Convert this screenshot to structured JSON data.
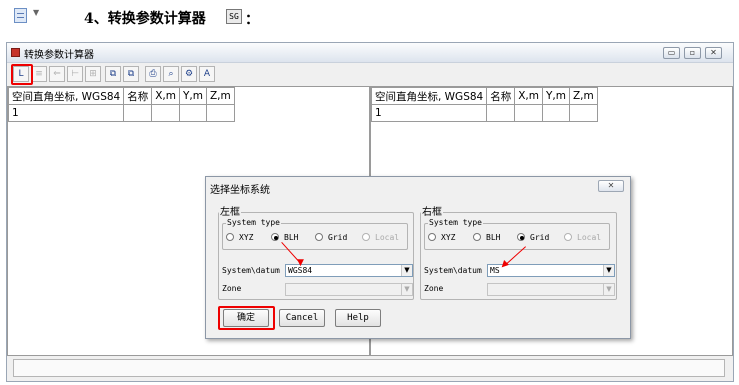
{
  "doc": {
    "heading": "4、转换参数计算器",
    "heading_icon_text": "SG",
    "heading_colon": "："
  },
  "window": {
    "title": "转换参数计算器",
    "controls": [
      "▭",
      "▫",
      "✕"
    ],
    "toolbar": [
      {
        "icon": "new-table-icon",
        "glyph": "L",
        "enabled": true,
        "highlighted": true
      },
      {
        "icon": "open-icon",
        "glyph": "≡",
        "enabled": false
      },
      {
        "icon": "import-icon",
        "glyph": "⇐",
        "enabled": false
      },
      {
        "icon": "export-icon",
        "glyph": "⊢",
        "enabled": false
      },
      {
        "icon": "calculate-icon",
        "glyph": "⊞",
        "enabled": false
      },
      {
        "icon": "copy-left-icon",
        "glyph": "⧉",
        "enabled": true
      },
      {
        "icon": "copy-right-icon",
        "glyph": "⧉",
        "enabled": true
      },
      {
        "icon": "print-icon",
        "glyph": "⎙",
        "enabled": true
      },
      {
        "icon": "preview-icon",
        "glyph": "⌕",
        "enabled": true
      },
      {
        "icon": "settings-icon",
        "glyph": "⚙",
        "enabled": true
      },
      {
        "icon": "font-icon",
        "glyph": "A",
        "enabled": true
      }
    ]
  },
  "left_table": {
    "headers": [
      "空间直角坐标, WGS84",
      "名称",
      "X,m",
      "Y,m",
      "Z,m"
    ],
    "rows": [
      [
        "1",
        "",
        "",
        "",
        ""
      ]
    ]
  },
  "right_table": {
    "headers": [
      "空间直角坐标, WGS84",
      "名称",
      "X,m",
      "Y,m",
      "Z,m"
    ],
    "rows": [
      [
        "1",
        "",
        "",
        "",
        ""
      ]
    ]
  },
  "dialog": {
    "title": "选择坐标系统",
    "close": "✕",
    "left": {
      "frame": "左框",
      "system_type_label": "System type",
      "options": [
        {
          "label": "XYZ",
          "selected": false,
          "enabled": true
        },
        {
          "label": "BLH",
          "selected": true,
          "enabled": true
        },
        {
          "label": "Grid",
          "selected": false,
          "enabled": true
        },
        {
          "label": "Local",
          "selected": false,
          "enabled": false
        }
      ],
      "datum_label": "System\\datum",
      "datum_value": "WGS84",
      "zone_label": "Zone",
      "zone_value": ""
    },
    "right": {
      "frame": "右框",
      "system_type_label": "System type",
      "options": [
        {
          "label": "XYZ",
          "selected": false,
          "enabled": true
        },
        {
          "label": "BLH",
          "selected": false,
          "enabled": true
        },
        {
          "label": "Grid",
          "selected": true,
          "enabled": true
        },
        {
          "label": "Local",
          "selected": false,
          "enabled": false
        }
      ],
      "datum_label": "System\\datum",
      "datum_value": "MS",
      "zone_label": "Zone",
      "zone_value": ""
    },
    "buttons": {
      "ok": "确定",
      "cancel": "Cancel",
      "help": "Help"
    }
  },
  "accent": "#ee0000"
}
